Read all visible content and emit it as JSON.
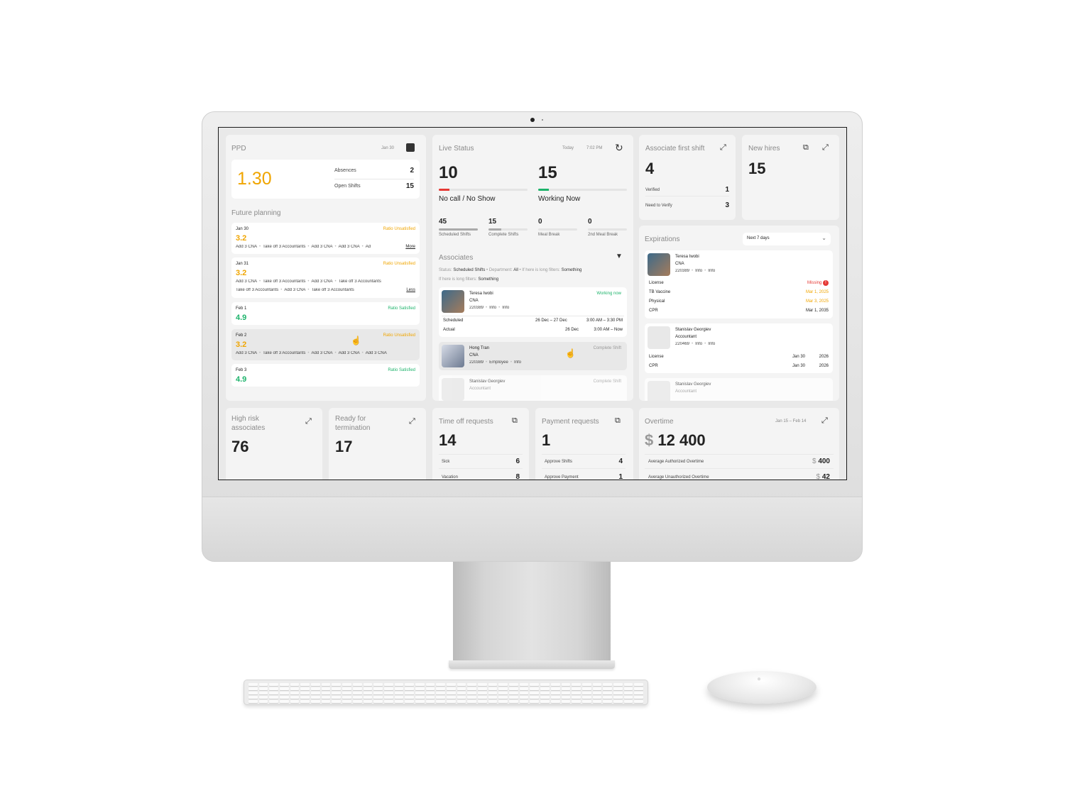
{
  "ppd": {
    "title": "PPD",
    "date": "Jan 30",
    "value": "1.30",
    "absences_label": "Absences",
    "absences": "2",
    "open_label": "Open Shifts",
    "open": "15"
  },
  "future": {
    "title": "Future planning",
    "more": "More",
    "less": "Less",
    "items": [
      {
        "date": "Jan 30",
        "status": "Ratio Unsatisfied",
        "value": "3.2",
        "chips1": [
          "Add 3 CNA",
          "Take off 3 Accountants",
          "Add 3 CNA",
          "Add 3 CNA",
          "Ad"
        ],
        "chips2": []
      },
      {
        "date": "Jan 31",
        "status": "Ratio Unsatisfied",
        "value": "3.2",
        "chips1": [
          "Add 3 CNA",
          "Take off 3 Accountants",
          "Add 3 CNA",
          "Take off 3 Accountants"
        ],
        "chips2": [
          "Take off 3 Accountants",
          "Add 3 CNA",
          "Take off 3 Accountants"
        ]
      },
      {
        "date": "Feb 1",
        "status": "Ratio Satisfied",
        "value": "4.9",
        "chips1": [],
        "chips2": []
      },
      {
        "date": "Feb 2",
        "status": "Ratio Unsatisfied",
        "value": "3.2",
        "chips1": [
          "Add 3 CNA",
          "Take off 3 Accountants",
          "Add 3 CNA",
          "Add 3 CNA",
          "Add 3 CNA"
        ],
        "chips2": []
      },
      {
        "date": "Feb 3",
        "status": "Ratio Satisfied",
        "value": "4.9",
        "chips1": [],
        "chips2": []
      }
    ]
  },
  "live": {
    "title": "Live Status",
    "day": "Today",
    "time": "7:02 PM",
    "nocall": {
      "value": "10",
      "label": "No call / No Show",
      "level": 0.12
    },
    "working": {
      "value": "15",
      "label": "Working Now",
      "level": 0.12
    },
    "mini": [
      {
        "value": "45",
        "label": "Scheduled Shifts",
        "level": 1
      },
      {
        "value": "15",
        "label": "Complete Shifts",
        "level": 0.33
      },
      {
        "value": "0",
        "label": "Meal Break",
        "level": 0
      },
      {
        "value": "0",
        "label": "2nd Meal Break",
        "level": 0
      }
    ]
  },
  "associates": {
    "title": "Associates",
    "filter1": {
      "k1": "Status:",
      "v1": "Scheduled Shifts",
      "k2": "Department:",
      "v2": "All",
      "k3": "If here is long filters:",
      "v3": "Something"
    },
    "filter2": {
      "k": "If here is long filters:",
      "v": "Something"
    },
    "p1": {
      "name": "Teresa Iwobi",
      "role": "CNA",
      "id": "220389",
      "i1": "Info",
      "i2": "Info",
      "status": "Working now",
      "sched_label": "Scheduled",
      "sched_date": "26 Dec – 27 Dec",
      "sched_time": "3:00 AM – 3:30 PM",
      "act_label": "Actual",
      "act_date": "26 Dec",
      "act_time": "3:00 AM – Now"
    },
    "p2": {
      "name": "Hong Tran",
      "role": "CNA",
      "id": "220389",
      "i1": "Employee",
      "i2": "Info",
      "status": "Complete Shift"
    },
    "p3": {
      "name": "Stanislav Georgiev",
      "role": "Accountant",
      "status": "Complete Shift"
    }
  },
  "afs": {
    "title": "Associate first shift",
    "value": "4",
    "verified_label": "Verified",
    "verified": "1",
    "need_label": "Need to Verify",
    "need": "3"
  },
  "newhires": {
    "title": "New hires",
    "value": "15"
  },
  "exp": {
    "title": "Expirations",
    "select": "Next 7 days",
    "p1": {
      "name": "Teresa Iwobi",
      "role": "CNA",
      "id": "220389",
      "i1": "Info",
      "i2": "Info",
      "rows": [
        {
          "k": "License",
          "v": "Missing",
          "c": "red"
        },
        {
          "k": "TB Vaccine",
          "v": "Mar 1, 2025",
          "c": "orange"
        },
        {
          "k": "Physical",
          "v": "Mar 3, 2025",
          "c": "orange"
        },
        {
          "k": "CPR",
          "v": "Mar 1, 2035",
          "c": ""
        }
      ]
    },
    "p2": {
      "name": "Stanislav Georgiev",
      "role": "Accountant",
      "id": "220469",
      "i1": "Info",
      "i2": "Info",
      "rows": [
        {
          "k": "License",
          "d": "Jan 30",
          "y": "2026"
        },
        {
          "k": "CPR",
          "d": "Jan 30",
          "y": "2026"
        }
      ]
    },
    "p3": {
      "name": "Stanislav Georgiev",
      "role": "Accountant"
    }
  },
  "highrisk": {
    "title1": "High risk",
    "title2": "associates",
    "value": "76"
  },
  "ready": {
    "title1": "Ready for",
    "title2": "termination",
    "value": "17"
  },
  "timeoff": {
    "title": "Time off requests",
    "value": "14",
    "r1k": "Sick",
    "r1v": "6",
    "r2k": "Vacation",
    "r2v": "8"
  },
  "payment": {
    "title": "Payment requests",
    "value": "1",
    "r1k": "Approve Shifts",
    "r1v": "4",
    "r2k": "Approve Payment",
    "r2v": "1"
  },
  "overtime": {
    "title": "Overtime",
    "range": "Jan 15 – Feb 14",
    "currency": "$",
    "value": "12 400",
    "r1k": "Average Authorized Overtime",
    "r1v": "400",
    "r2k": "Average Unauthorized Overtime",
    "r2v": "42"
  }
}
